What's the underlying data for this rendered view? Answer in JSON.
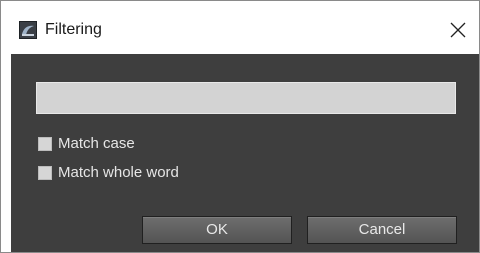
{
  "window": {
    "title": "Filtering",
    "icon": "app-logo-icon",
    "close_icon": "close-icon"
  },
  "filter": {
    "value": "",
    "placeholder": ""
  },
  "options": [
    {
      "label": "Match case",
      "checked": false
    },
    {
      "label": "Match whole word",
      "checked": false
    }
  ],
  "buttons": {
    "ok_label": "OK",
    "cancel_label": "Cancel"
  },
  "colors": {
    "client_background": "#3e3e3e",
    "input_background": "#d3d3d3",
    "button_background": "#5f5f5f",
    "text_light": "#e6e6e6"
  }
}
